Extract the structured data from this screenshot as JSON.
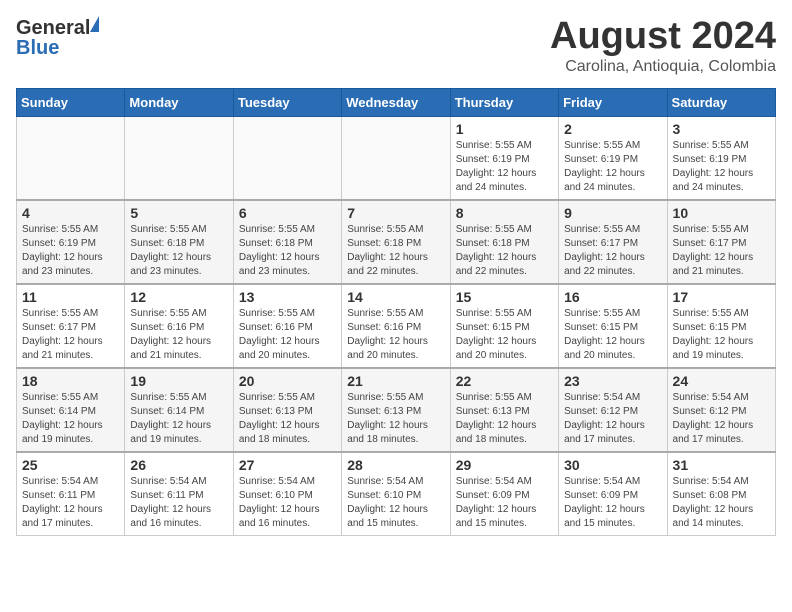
{
  "header": {
    "logo_general": "General",
    "logo_blue": "Blue",
    "title": "August 2024",
    "subtitle": "Carolina, Antioquia, Colombia"
  },
  "weekdays": [
    "Sunday",
    "Monday",
    "Tuesday",
    "Wednesday",
    "Thursday",
    "Friday",
    "Saturday"
  ],
  "weeks": [
    [
      {
        "day": "",
        "info": ""
      },
      {
        "day": "",
        "info": ""
      },
      {
        "day": "",
        "info": ""
      },
      {
        "day": "",
        "info": ""
      },
      {
        "day": "1",
        "info": "Sunrise: 5:55 AM\nSunset: 6:19 PM\nDaylight: 12 hours\nand 24 minutes."
      },
      {
        "day": "2",
        "info": "Sunrise: 5:55 AM\nSunset: 6:19 PM\nDaylight: 12 hours\nand 24 minutes."
      },
      {
        "day": "3",
        "info": "Sunrise: 5:55 AM\nSunset: 6:19 PM\nDaylight: 12 hours\nand 24 minutes."
      }
    ],
    [
      {
        "day": "4",
        "info": "Sunrise: 5:55 AM\nSunset: 6:19 PM\nDaylight: 12 hours\nand 23 minutes."
      },
      {
        "day": "5",
        "info": "Sunrise: 5:55 AM\nSunset: 6:18 PM\nDaylight: 12 hours\nand 23 minutes."
      },
      {
        "day": "6",
        "info": "Sunrise: 5:55 AM\nSunset: 6:18 PM\nDaylight: 12 hours\nand 23 minutes."
      },
      {
        "day": "7",
        "info": "Sunrise: 5:55 AM\nSunset: 6:18 PM\nDaylight: 12 hours\nand 22 minutes."
      },
      {
        "day": "8",
        "info": "Sunrise: 5:55 AM\nSunset: 6:18 PM\nDaylight: 12 hours\nand 22 minutes."
      },
      {
        "day": "9",
        "info": "Sunrise: 5:55 AM\nSunset: 6:17 PM\nDaylight: 12 hours\nand 22 minutes."
      },
      {
        "day": "10",
        "info": "Sunrise: 5:55 AM\nSunset: 6:17 PM\nDaylight: 12 hours\nand 21 minutes."
      }
    ],
    [
      {
        "day": "11",
        "info": "Sunrise: 5:55 AM\nSunset: 6:17 PM\nDaylight: 12 hours\nand 21 minutes."
      },
      {
        "day": "12",
        "info": "Sunrise: 5:55 AM\nSunset: 6:16 PM\nDaylight: 12 hours\nand 21 minutes."
      },
      {
        "day": "13",
        "info": "Sunrise: 5:55 AM\nSunset: 6:16 PM\nDaylight: 12 hours\nand 20 minutes."
      },
      {
        "day": "14",
        "info": "Sunrise: 5:55 AM\nSunset: 6:16 PM\nDaylight: 12 hours\nand 20 minutes."
      },
      {
        "day": "15",
        "info": "Sunrise: 5:55 AM\nSunset: 6:15 PM\nDaylight: 12 hours\nand 20 minutes."
      },
      {
        "day": "16",
        "info": "Sunrise: 5:55 AM\nSunset: 6:15 PM\nDaylight: 12 hours\nand 20 minutes."
      },
      {
        "day": "17",
        "info": "Sunrise: 5:55 AM\nSunset: 6:15 PM\nDaylight: 12 hours\nand 19 minutes."
      }
    ],
    [
      {
        "day": "18",
        "info": "Sunrise: 5:55 AM\nSunset: 6:14 PM\nDaylight: 12 hours\nand 19 minutes."
      },
      {
        "day": "19",
        "info": "Sunrise: 5:55 AM\nSunset: 6:14 PM\nDaylight: 12 hours\nand 19 minutes."
      },
      {
        "day": "20",
        "info": "Sunrise: 5:55 AM\nSunset: 6:13 PM\nDaylight: 12 hours\nand 18 minutes."
      },
      {
        "day": "21",
        "info": "Sunrise: 5:55 AM\nSunset: 6:13 PM\nDaylight: 12 hours\nand 18 minutes."
      },
      {
        "day": "22",
        "info": "Sunrise: 5:55 AM\nSunset: 6:13 PM\nDaylight: 12 hours\nand 18 minutes."
      },
      {
        "day": "23",
        "info": "Sunrise: 5:54 AM\nSunset: 6:12 PM\nDaylight: 12 hours\nand 17 minutes."
      },
      {
        "day": "24",
        "info": "Sunrise: 5:54 AM\nSunset: 6:12 PM\nDaylight: 12 hours\nand 17 minutes."
      }
    ],
    [
      {
        "day": "25",
        "info": "Sunrise: 5:54 AM\nSunset: 6:11 PM\nDaylight: 12 hours\nand 17 minutes."
      },
      {
        "day": "26",
        "info": "Sunrise: 5:54 AM\nSunset: 6:11 PM\nDaylight: 12 hours\nand 16 minutes."
      },
      {
        "day": "27",
        "info": "Sunrise: 5:54 AM\nSunset: 6:10 PM\nDaylight: 12 hours\nand 16 minutes."
      },
      {
        "day": "28",
        "info": "Sunrise: 5:54 AM\nSunset: 6:10 PM\nDaylight: 12 hours\nand 15 minutes."
      },
      {
        "day": "29",
        "info": "Sunrise: 5:54 AM\nSunset: 6:09 PM\nDaylight: 12 hours\nand 15 minutes."
      },
      {
        "day": "30",
        "info": "Sunrise: 5:54 AM\nSunset: 6:09 PM\nDaylight: 12 hours\nand 15 minutes."
      },
      {
        "day": "31",
        "info": "Sunrise: 5:54 AM\nSunset: 6:08 PM\nDaylight: 12 hours\nand 14 minutes."
      }
    ]
  ]
}
